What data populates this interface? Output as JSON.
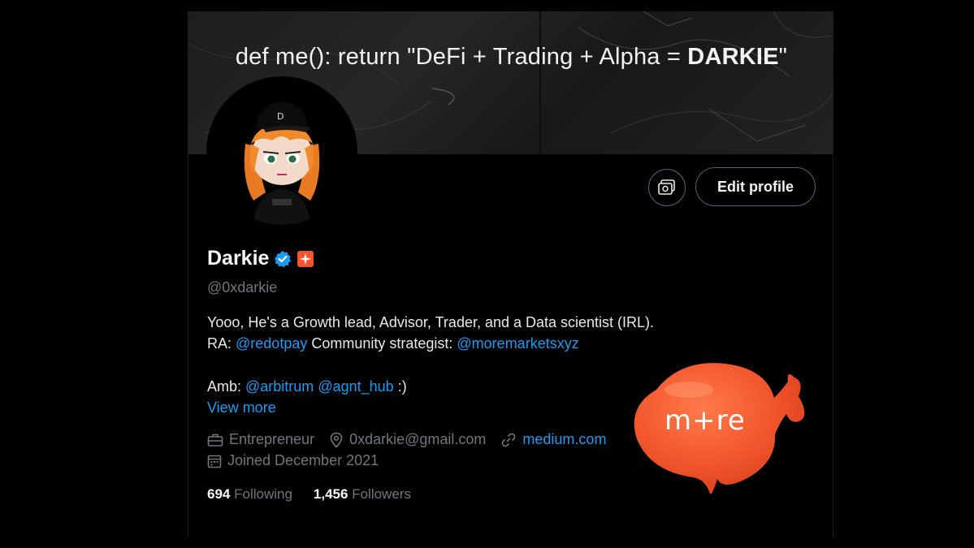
{
  "banner": {
    "text_prefix": "def me(): return \"DeFi + Trading + Alpha = ",
    "text_bold": "DARKIE",
    "text_suffix": "\""
  },
  "avatar": {
    "icon": "cartoon-avatar"
  },
  "actions": {
    "media_button_icon": "camera-frame-icon",
    "edit_profile_label": "Edit profile"
  },
  "profile": {
    "name": "Darkie",
    "verified_icon": "verified-badge-icon",
    "affiliate_icon": "affiliate-badge-icon",
    "handle": "@0xdarkie"
  },
  "bio": {
    "line1": "Yooo, He's a Growth lead, Advisor, Trader, and a Data scientist (IRL).",
    "line2_prefix": "RA: ",
    "line2_mention1": "@redotpay",
    "line2_middle": " Community strategist: ",
    "line2_mention2": "@moremarketsxyz",
    "line3_prefix": "Amb: ",
    "line3_mention1": "@arbitrum",
    "line3_mention2": "@agnt_hub",
    "line3_suffix": " :)"
  },
  "view_more": "View more",
  "meta": {
    "profession": "Entrepreneur",
    "location": "0xdarkie@gmail.com",
    "website": "medium.com",
    "joined": "Joined December 2021"
  },
  "stats": {
    "following_count": "694",
    "following_label": "Following",
    "followers_count": "1,456",
    "followers_label": "Followers"
  },
  "overlay_logo": {
    "text": "m+re"
  },
  "colors": {
    "accent": "#1d9bf0",
    "muted": "#71767b",
    "logo_orange": "#f2552c"
  }
}
